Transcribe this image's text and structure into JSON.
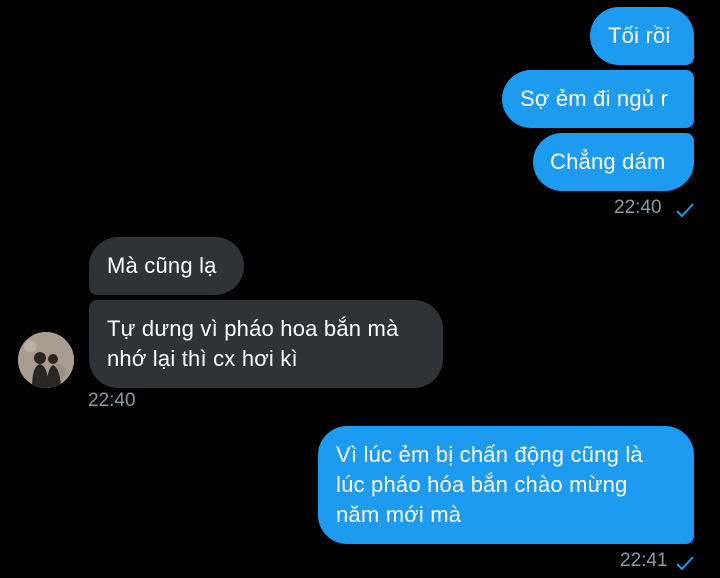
{
  "messages": {
    "out1": "Tối rồi",
    "out2": "Sợ ẻm đi ngủ r",
    "out3": "Chẳng dám",
    "out_group1_time": "22:40",
    "in1": "Mà cũng lạ",
    "in2_line1": "Tự dưng vì pháo hoa bắn mà",
    "in2_line2": "nhớ lại thì cx hơi kì",
    "in_group_time": "22:40",
    "out4_line1": "Vì lúc ẻm bị chấn động cũng là",
    "out4_line2": "lúc pháo hóa bắn chào mừng",
    "out4_line3": "năm mới mà",
    "out_group2_time": "22:41"
  },
  "colors": {
    "outgoing_bubble": "#1d9bf0",
    "incoming_bubble": "#2f3336",
    "timestamp": "#8b98a5",
    "read_check": "#1d9bf0"
  },
  "icons": {
    "read_receipt": "check-icon",
    "contact_avatar": "avatar"
  }
}
